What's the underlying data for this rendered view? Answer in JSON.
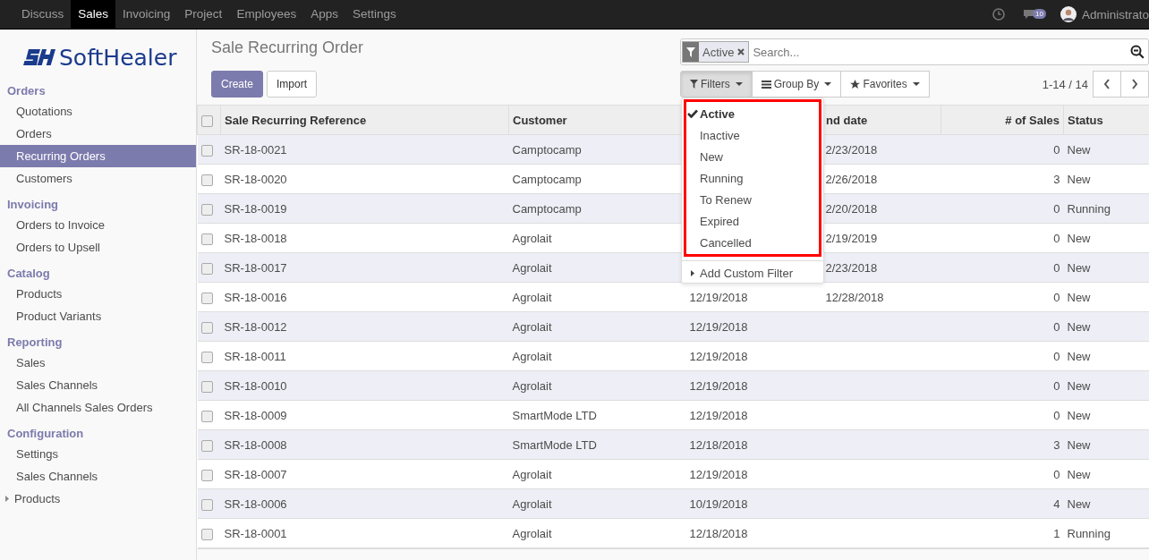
{
  "top_menu": [
    {
      "label": "Discuss",
      "selected": false
    },
    {
      "label": "Sales",
      "selected": true
    },
    {
      "label": "Invoicing",
      "selected": false
    },
    {
      "label": "Project",
      "selected": false
    },
    {
      "label": "Employees",
      "selected": false
    },
    {
      "label": "Apps",
      "selected": false
    },
    {
      "label": "Settings",
      "selected": false
    }
  ],
  "systray": {
    "message_count": "10",
    "user": "Administrato"
  },
  "logo": {
    "text": "SoftHealer"
  },
  "sidebar": [
    {
      "heading": "Orders",
      "items": [
        {
          "label": "Quotations",
          "selected": false
        },
        {
          "label": "Orders",
          "selected": false
        },
        {
          "label": "Recurring Orders",
          "selected": true
        },
        {
          "label": "Customers",
          "selected": false
        }
      ]
    },
    {
      "heading": "Invoicing",
      "items": [
        {
          "label": "Orders to Invoice",
          "selected": false
        },
        {
          "label": "Orders to Upsell",
          "selected": false
        }
      ]
    },
    {
      "heading": "Catalog",
      "items": [
        {
          "label": "Products",
          "selected": false
        },
        {
          "label": "Product Variants",
          "selected": false
        }
      ]
    },
    {
      "heading": "Reporting",
      "items": [
        {
          "label": "Sales",
          "selected": false
        },
        {
          "label": "Sales Channels",
          "selected": false
        },
        {
          "label": "All Channels Sales Orders",
          "selected": false
        }
      ]
    },
    {
      "heading": "Configuration",
      "items": [
        {
          "label": "Settings",
          "selected": false
        },
        {
          "label": "Sales Channels",
          "selected": false
        },
        {
          "label": "Products",
          "selected": false,
          "expandable": true
        }
      ]
    }
  ],
  "page_title": "Sale Recurring Order",
  "buttons": {
    "create": "Create",
    "import": "Import"
  },
  "search": {
    "facet": "Active",
    "placeholder": "Search..."
  },
  "search_options": [
    {
      "label": "Filters",
      "kind": "filter",
      "open": true
    },
    {
      "label": "Group By",
      "kind": "group",
      "open": false
    },
    {
      "label": "Favorites",
      "kind": "star",
      "open": false
    }
  ],
  "pager": "1-14 / 14",
  "filters_menu": {
    "items": [
      {
        "label": "Active",
        "selected": true
      },
      {
        "label": "Inactive",
        "selected": false
      },
      {
        "label": "New",
        "selected": false
      },
      {
        "label": "Running",
        "selected": false
      },
      {
        "label": "To Renew",
        "selected": false
      },
      {
        "label": "Expired",
        "selected": false
      },
      {
        "label": "Cancelled",
        "selected": false
      }
    ],
    "custom": "Add Custom Filter"
  },
  "table": {
    "select_all": {
      "checked": false
    },
    "columns": [
      "Sale Recurring Reference",
      "Customer",
      "",
      "nd date",
      "# of Sales",
      "Status"
    ],
    "rows": [
      {
        "checked": false,
        "ref": "SR-18-0021",
        "customer": "Camptocamp",
        "column_3": "",
        "end": "2/23/2018",
        "sales": "0",
        "status": "New"
      },
      {
        "checked": false,
        "ref": "SR-18-0020",
        "customer": "Camptocamp",
        "column_3": "",
        "end": "2/26/2018",
        "sales": "3",
        "status": "New"
      },
      {
        "checked": false,
        "ref": "SR-18-0019",
        "customer": "Camptocamp",
        "column_3": "",
        "end": "2/20/2018",
        "sales": "0",
        "status": "Running"
      },
      {
        "checked": false,
        "ref": "SR-18-0018",
        "customer": "Agrolait",
        "column_3": "",
        "end": "2/19/2019",
        "sales": "0",
        "status": "New"
      },
      {
        "checked": false,
        "ref": "SR-18-0017",
        "customer": "Agrolait",
        "column_3": "",
        "end": "2/23/2018",
        "sales": "0",
        "status": "New"
      },
      {
        "checked": false,
        "ref": "SR-18-0016",
        "customer": "Agrolait",
        "column_3": "12/19/2018",
        "end": "12/28/2018",
        "sales": "0",
        "status": "New"
      },
      {
        "checked": false,
        "ref": "SR-18-0012",
        "customer": "Agrolait",
        "column_3": "12/19/2018",
        "end": "",
        "sales": "0",
        "status": "New"
      },
      {
        "checked": false,
        "ref": "SR-18-0011",
        "customer": "Agrolait",
        "column_3": "12/19/2018",
        "end": "",
        "sales": "0",
        "status": "New"
      },
      {
        "checked": false,
        "ref": "SR-18-0010",
        "customer": "Agrolait",
        "column_3": "12/19/2018",
        "end": "",
        "sales": "0",
        "status": "New"
      },
      {
        "checked": false,
        "ref": "SR-18-0009",
        "customer": "SmartMode LTD",
        "column_3": "12/19/2018",
        "end": "",
        "sales": "0",
        "status": "New"
      },
      {
        "checked": false,
        "ref": "SR-18-0008",
        "customer": "SmartMode LTD",
        "column_3": "12/18/2018",
        "end": "",
        "sales": "3",
        "status": "New"
      },
      {
        "checked": false,
        "ref": "SR-18-0007",
        "customer": "Agrolait",
        "column_3": "12/19/2018",
        "end": "",
        "sales": "0",
        "status": "New"
      },
      {
        "checked": false,
        "ref": "SR-18-0006",
        "customer": "Agrolait",
        "column_3": "10/19/2018",
        "end": "",
        "sales": "4",
        "status": "New"
      },
      {
        "checked": false,
        "ref": "SR-18-0001",
        "customer": "Agrolait",
        "column_3": "12/18/2018",
        "end": "",
        "sales": "1",
        "status": "Running"
      }
    ]
  }
}
